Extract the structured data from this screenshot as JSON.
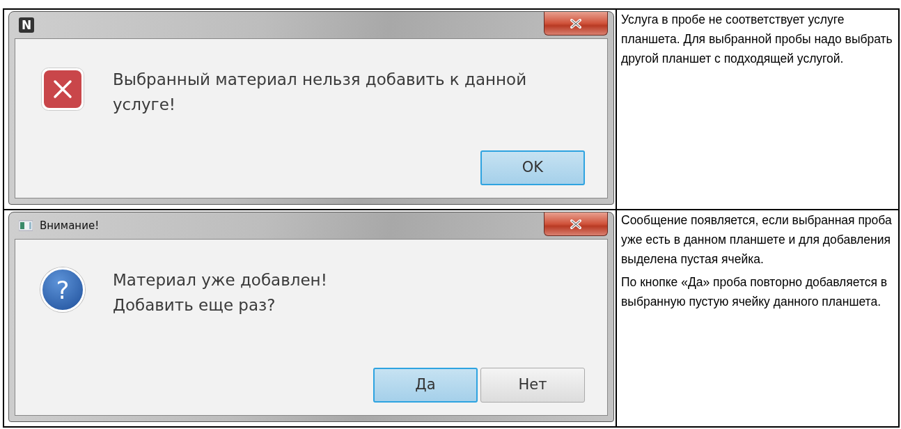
{
  "rows": [
    {
      "dialog": {
        "title_icon": {
          "kind": "letter",
          "text": "N"
        },
        "icon": {
          "kind": "error"
        },
        "message_lines": [
          "Выбранный материал нельзя добавить к данной",
          "услуге!"
        ],
        "buttons": [
          {
            "label": "OK",
            "default": true
          }
        ]
      },
      "description": [
        "Услуга в пробе не соответствует услуге планшета. Для выбранной пробы надо выбрать другой планшет с подходящей услугой."
      ]
    },
    {
      "dialog": {
        "title_icon": {
          "kind": "window"
        },
        "title": "Внимание!",
        "icon": {
          "kind": "question",
          "symbol": "?"
        },
        "message_lines": [
          "Материал уже добавлен!",
          "Добавить еще раз?"
        ],
        "buttons": [
          {
            "label": "Да",
            "default": true
          },
          {
            "label": "Нет",
            "default": false
          }
        ]
      },
      "description": [
        "Сообщение появляется, если выбранная проба уже есть в данном планшете и для добавления выделена пустая ячейка.",
        "По кнопке «Да» проба повторно добавляется в выбранную пустую ячейку данного планшета."
      ]
    }
  ]
}
